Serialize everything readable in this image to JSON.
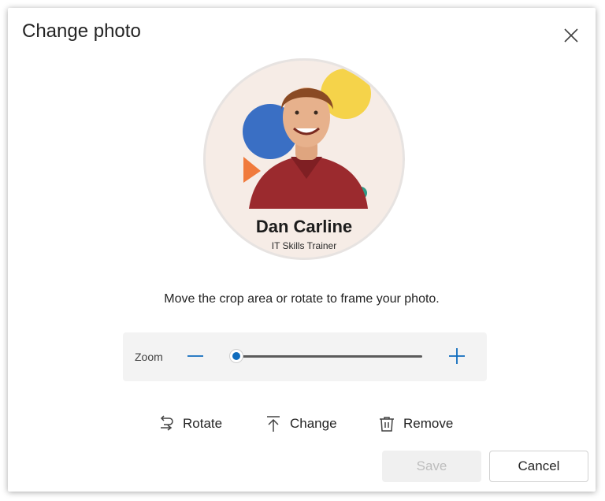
{
  "dialog": {
    "title": "Change photo",
    "close_icon": "close-icon"
  },
  "photo": {
    "name": "Dan Carline",
    "role": "IT Skills Trainer",
    "colors": {
      "background": "#f6ece6",
      "blue_circle": "#3a6fc4",
      "yellow_circle": "#f5d34a",
      "orange_triangle": "#f07a3c",
      "teal_dot": "#2f9a87",
      "shirt": "#9b2a2e",
      "skin": "#e7b18c",
      "hair": "#8a4a24"
    }
  },
  "instructions": "Move the crop area or rotate to frame your photo.",
  "zoom": {
    "label": "Zoom",
    "minus_icon": "minus-icon",
    "plus_icon": "plus-icon",
    "level": 0,
    "accent": "#0f6cbd"
  },
  "actions": {
    "rotate": {
      "label": "Rotate",
      "icon": "rotate-icon"
    },
    "change": {
      "label": "Change",
      "icon": "upload-icon"
    },
    "remove": {
      "label": "Remove",
      "icon": "trash-icon"
    }
  },
  "footer": {
    "save_label": "Save",
    "save_disabled": true,
    "cancel_label": "Cancel"
  }
}
